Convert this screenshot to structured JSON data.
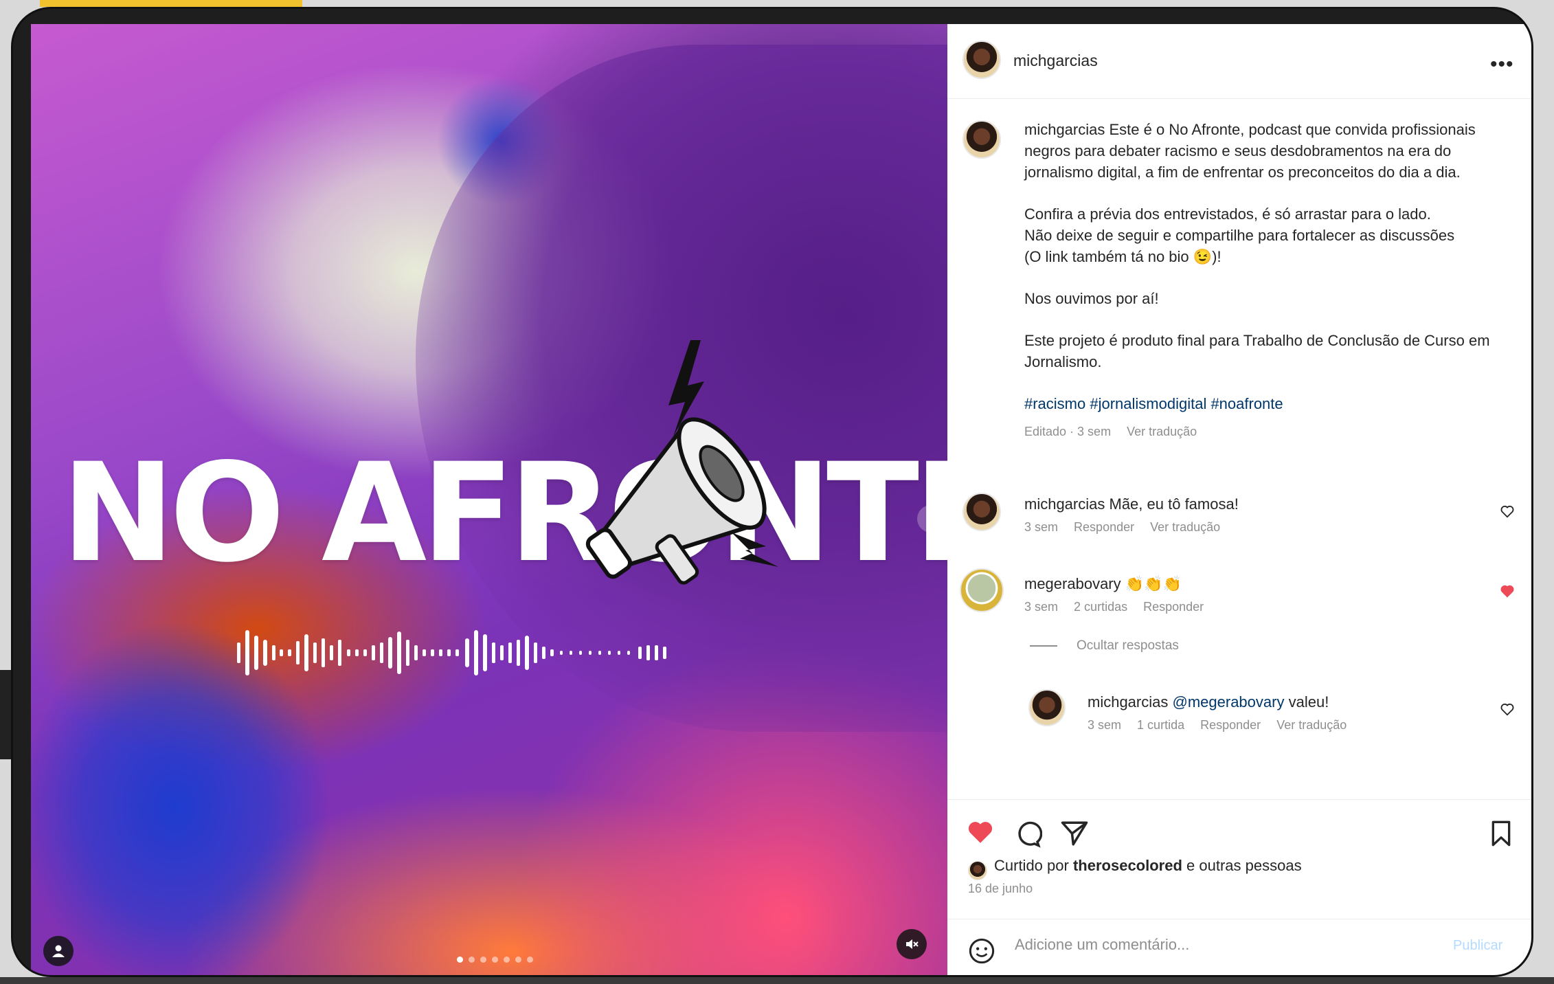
{
  "post": {
    "author": "michgarcias",
    "more_label": "•••",
    "title_art": "NO AFRONTE",
    "caption": {
      "username": "michgarcias",
      "p1": "Este é o No Afronte, podcast que convida profissionais negros para debater racismo e seus desdobramentos na era do jornalismo digital, a fim de enfrentar os preconceitos do dia a dia.",
      "p2a": "Confira a prévia dos entrevistados, é só arrastar para o lado.",
      "p2b": "Não deixe de seguir e compartilhe para fortalecer as discussões",
      "p2c": "(O link também tá no bio 😉)!",
      "p3": "Nos ouvimos por aí!",
      "p4": "Este projeto é produto final para Trabalho de Conclusão de Curso em Jornalismo.",
      "hashtags": "#racismo #jornalismodigital #noafronte",
      "meta_edited": "Editado · 3 sem",
      "meta_translate": "Ver tradução"
    },
    "comments": [
      {
        "username": "michgarcias",
        "text": "Mãe, eu tô famosa!",
        "time": "3 sem",
        "reply": "Responder",
        "translate": "Ver tradução",
        "liked": false
      },
      {
        "username": "megerabovary",
        "text": "👏👏👏",
        "time": "3 sem",
        "likes": "2 curtidas",
        "reply": "Responder",
        "liked": true,
        "hide_replies": "Ocultar respostas",
        "replies": [
          {
            "username": "michgarcias",
            "mention": "@megerabovary",
            "text": "valeu!",
            "time": "3 sem",
            "likes": "1 curtida",
            "reply": "Responder",
            "translate": "Ver tradução",
            "liked": false
          }
        ]
      }
    ],
    "liked_by_prefix": "Curtido por",
    "liked_by_user": "therosecolored",
    "liked_by_suffix": "e outras pessoas",
    "date": "16 de junho",
    "add_comment_placeholder": "Adicione um comentário...",
    "publish_label": "Publicar",
    "slide_count": 7,
    "active_slide": 0,
    "post_liked": true
  },
  "icons": {
    "like": "heart-icon",
    "comment": "comment-icon",
    "share": "send-icon",
    "save": "bookmark-icon",
    "emoji": "emoji-icon",
    "mute": "volume-muted-icon",
    "tagged": "user-icon"
  },
  "colors": {
    "like_red": "#ed4956",
    "link_blue": "#00376b",
    "muted_text": "#8e8e8e",
    "publish_disabled": "#b3dbff"
  }
}
